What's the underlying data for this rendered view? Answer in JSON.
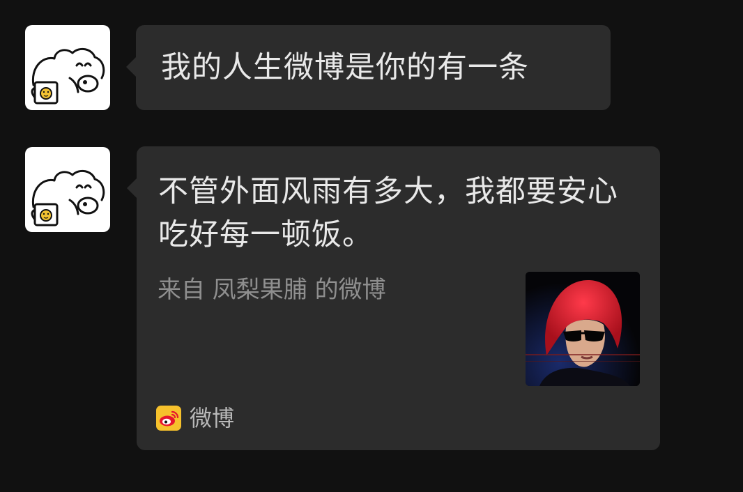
{
  "messages": [
    {
      "avatar_icon": "bear-with-mug-icon",
      "text": "我的人生微博是你的有一条"
    },
    {
      "avatar_icon": "bear-with-mug-icon",
      "card": {
        "text": "不管外面风雨有多大，我都要安心吃好每一顿饭。",
        "source": "来自 凤梨果脯 的微博",
        "thumbnail_icon": "red-hair-sunglasses-photo",
        "app_icon": "weibo-logo-icon",
        "app_name": "微博"
      }
    }
  ],
  "colors": {
    "background": "#111111",
    "bubble": "#2c2c2c",
    "text": "#e9e9e9",
    "muted_text": "#8f8f8f",
    "weibo_yellow": "#f6c12c"
  }
}
